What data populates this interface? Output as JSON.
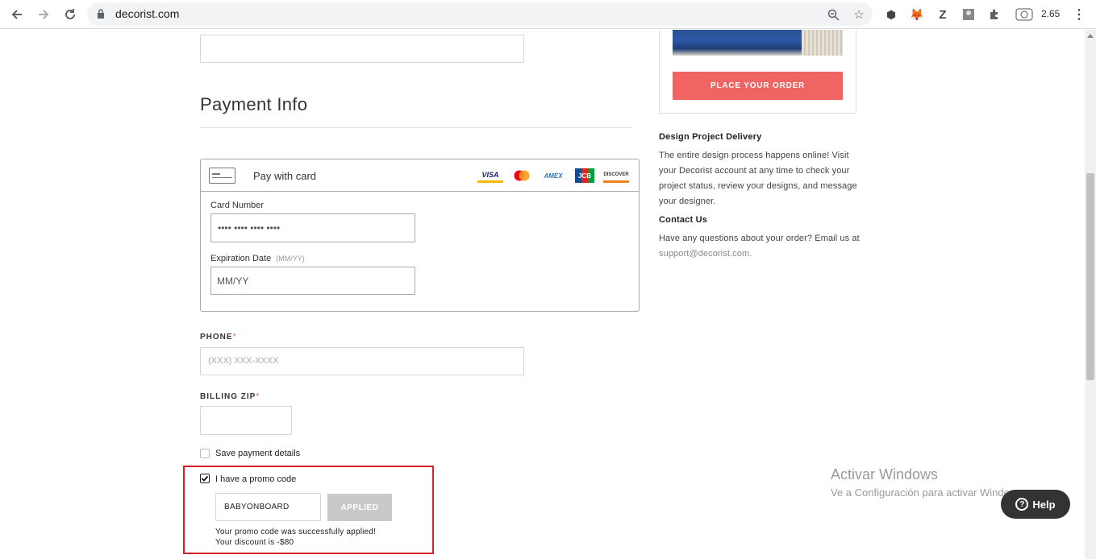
{
  "browser": {
    "url": "decorist.com",
    "extension_badge": "2.65"
  },
  "payment": {
    "heading": "Payment Info",
    "pay_with_card": "Pay with card",
    "card_brands": [
      "VISA",
      "AMEX",
      "JCB",
      "DISCOVER"
    ],
    "card_number_label": "Card Number",
    "card_number_placeholder": "•••• •••• •••• ••••",
    "expiration_label": "Expiration Date",
    "expiration_hint": "(MM/YY)",
    "expiration_placeholder": "MM/YY",
    "phone_label": "PHONE",
    "phone_placeholder": "(XXX) XXX-XXXX",
    "billing_zip_label": "BILLING ZIP",
    "required_mark": "*",
    "save_payment_label": "Save payment details",
    "save_payment_checked": false,
    "promo_label": "I have a promo code",
    "promo_checked": true,
    "promo_value": "BABYONBOARD",
    "applied_button": "APPLIED",
    "promo_success": "Your promo code was successfully applied!",
    "promo_discount": "Your discount is -$80"
  },
  "sidebar": {
    "place_order": "PLACE YOUR ORDER",
    "delivery_title": "Design Project Delivery",
    "delivery_text": "The entire design process happens online! Visit your Decorist account at any time to check your project status, review your designs, and message your designer.",
    "contact_title": "Contact Us",
    "contact_text": "Have any questions about your order? Email us at ",
    "contact_email": "support@decorist.com."
  },
  "overlay": {
    "activate_title": "Activar Windows",
    "activate_text": "Ve a Configuración para activar Windows.",
    "help_label": "Help"
  },
  "colors": {
    "accent": "#f06464",
    "highlight_border": "#d9202a"
  }
}
